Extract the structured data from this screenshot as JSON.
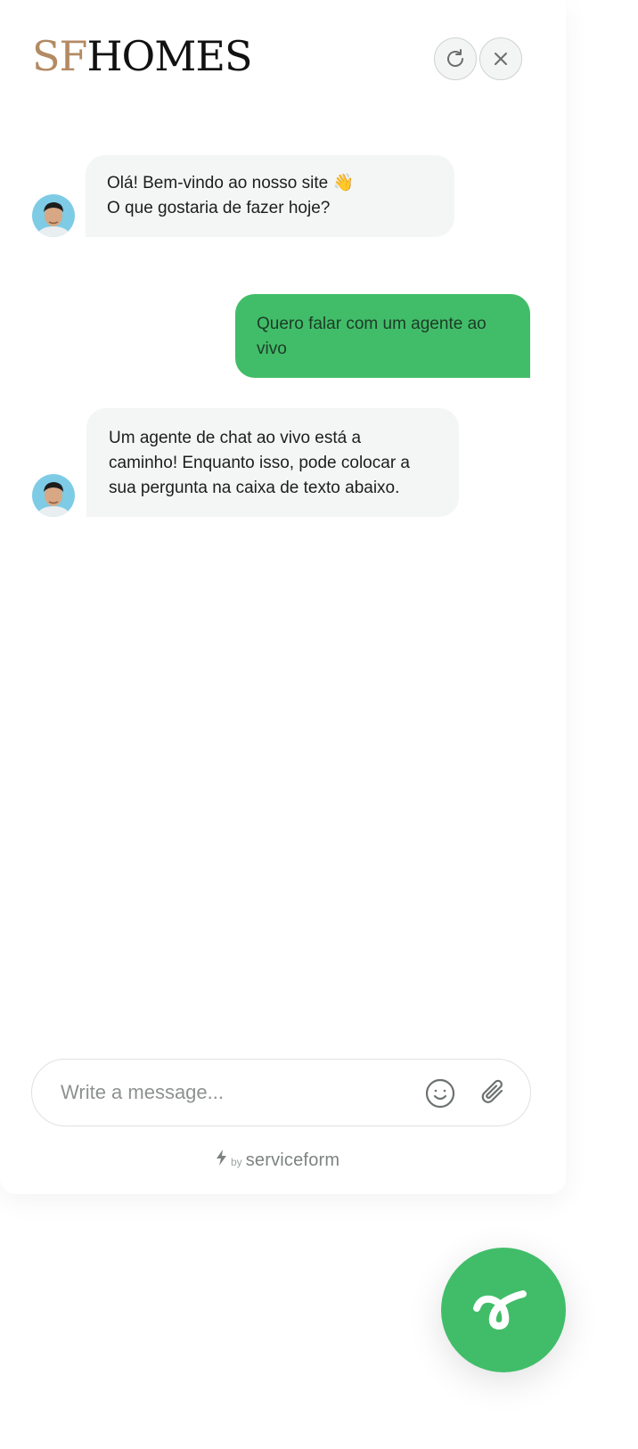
{
  "brand": {
    "logo_sf": "SF",
    "logo_homes": "HOMES"
  },
  "header": {
    "refresh_icon": "refresh-icon",
    "close_icon": "close-icon"
  },
  "messages": [
    {
      "from": "bot",
      "lines": [
        "Olá! Bem-vindo ao nosso site 👋",
        "O que gostaria de fazer hoje?"
      ]
    },
    {
      "from": "user",
      "lines": [
        "Quero falar com um agente ao",
        "vivo"
      ]
    },
    {
      "from": "bot",
      "lines": [
        "Um agente de chat ao vivo está a",
        "caminho! Enquanto isso, pode colocar a",
        "sua pergunta na caixa de texto abaixo."
      ]
    }
  ],
  "composer": {
    "placeholder": "Write a message...",
    "emoji_icon": "emoji-icon",
    "attach_icon": "paperclip-icon"
  },
  "footer": {
    "by": "by",
    "brand": "serviceform"
  },
  "colors": {
    "accent": "#41bd69",
    "logo_gold": "#b38a63",
    "bot_bubble": "#f4f5f5"
  }
}
